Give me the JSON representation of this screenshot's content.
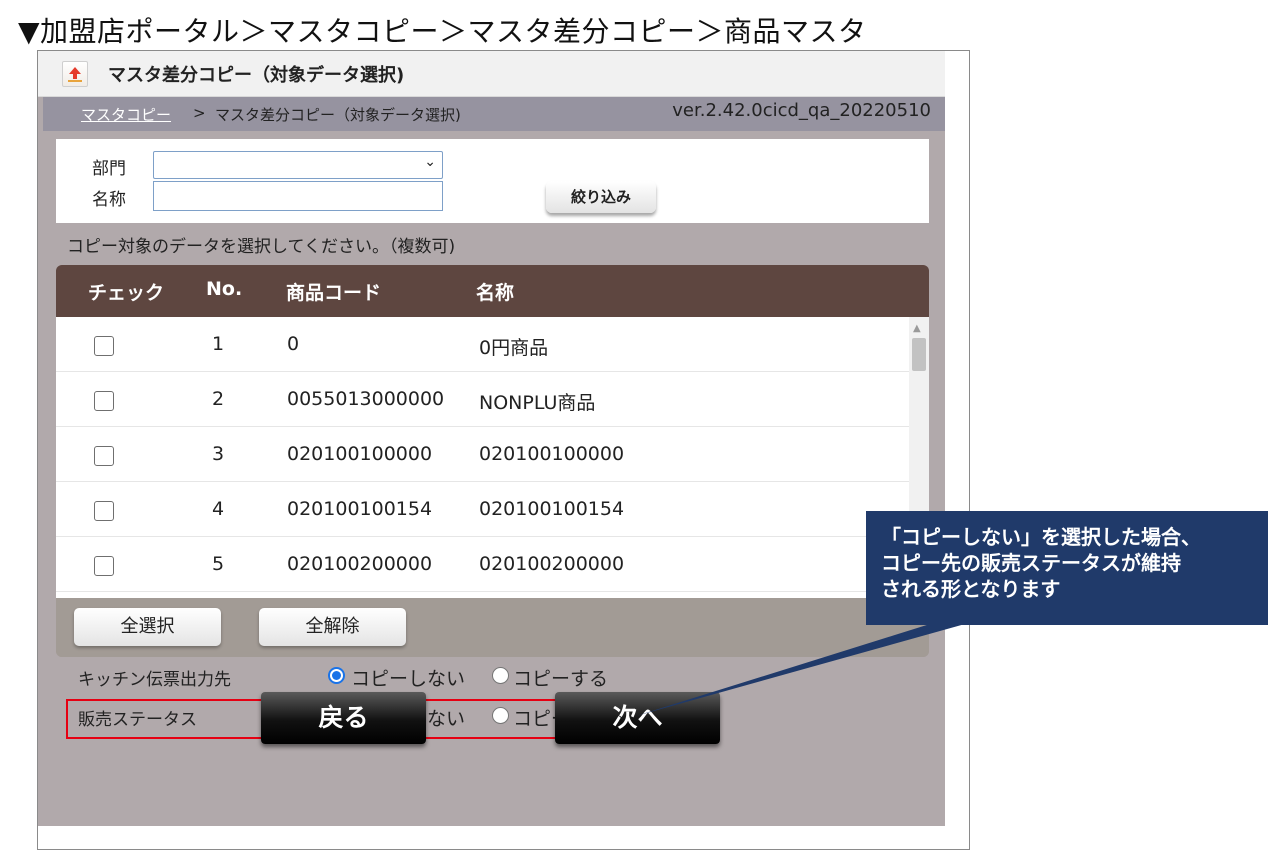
{
  "page_heading": "▼加盟店ポータル＞マスタコピー＞マスタ差分コピー＞商品マスタ",
  "window": {
    "title": "マスタ差分コピー（対象データ選択)",
    "icon": "upload-arrow-icon",
    "breadcrumb": {
      "link": "マスタコピー",
      "separator": ">",
      "current": "マスタ差分コピー（対象データ選択)"
    },
    "version": "ver.2.42.0cicd_qa_20220510"
  },
  "filter": {
    "department_label": "部門",
    "department_value": "",
    "name_label": "名称",
    "name_value": "",
    "filter_button": "絞り込み"
  },
  "instruction": "コピー対象のデータを選択してください。（複数可)",
  "grid": {
    "columns": [
      "チェック",
      "No.",
      "商品コード",
      "名称"
    ],
    "rows": [
      {
        "checked": false,
        "no": "1",
        "code": "0",
        "name": "0円商品"
      },
      {
        "checked": false,
        "no": "2",
        "code": "0055013000000",
        "name": "NONPLU商品"
      },
      {
        "checked": false,
        "no": "3",
        "code": "020100100000",
        "name": "020100100000"
      },
      {
        "checked": false,
        "no": "4",
        "code": "020100100154",
        "name": "020100100154"
      },
      {
        "checked": false,
        "no": "5",
        "code": "020100200000",
        "name": "020100200000"
      }
    ],
    "select_all": "全選択",
    "deselect_all": "全解除"
  },
  "options": [
    {
      "label": "キッチン伝票出力先",
      "choice_no_copy": "コピーしない",
      "choice_copy": "コピーする",
      "selected": "コピーしない"
    },
    {
      "label": "販売ステータス",
      "choice_no_copy": "コピーしない",
      "choice_copy": "コピーする",
      "selected": "コピーしない"
    }
  ],
  "buttons": {
    "back": "戻る",
    "next": "次へ"
  },
  "callout": {
    "lines": [
      "「コピーしない」を選択した場合、",
      "コピー先の販売ステータスが維持",
      "される形となります"
    ]
  },
  "colors": {
    "grid_header": "#5e4640",
    "callout": "#203a6a",
    "highlight_border": "#e60012",
    "app_background": "#b1a9ab"
  }
}
